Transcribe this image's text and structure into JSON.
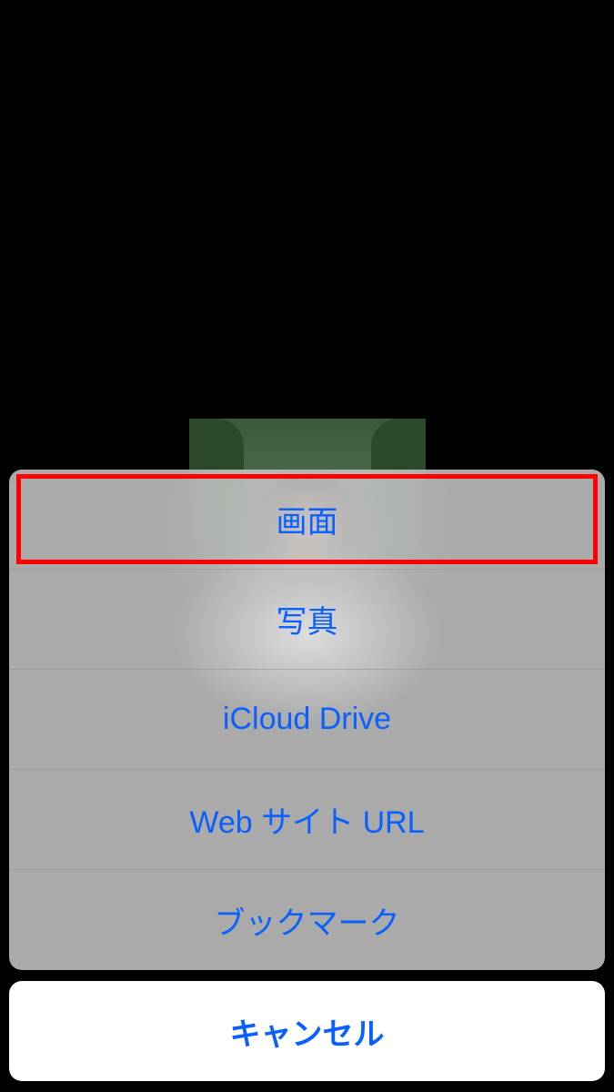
{
  "actionSheet": {
    "options": [
      {
        "label": "画面",
        "highlighted": true
      },
      {
        "label": "写真",
        "highlighted": false
      },
      {
        "label": "iCloud Drive",
        "highlighted": false
      },
      {
        "label": "Web サイト URL",
        "highlighted": false
      },
      {
        "label": "ブックマーク",
        "highlighted": false
      }
    ],
    "cancelLabel": "キャンセル"
  }
}
